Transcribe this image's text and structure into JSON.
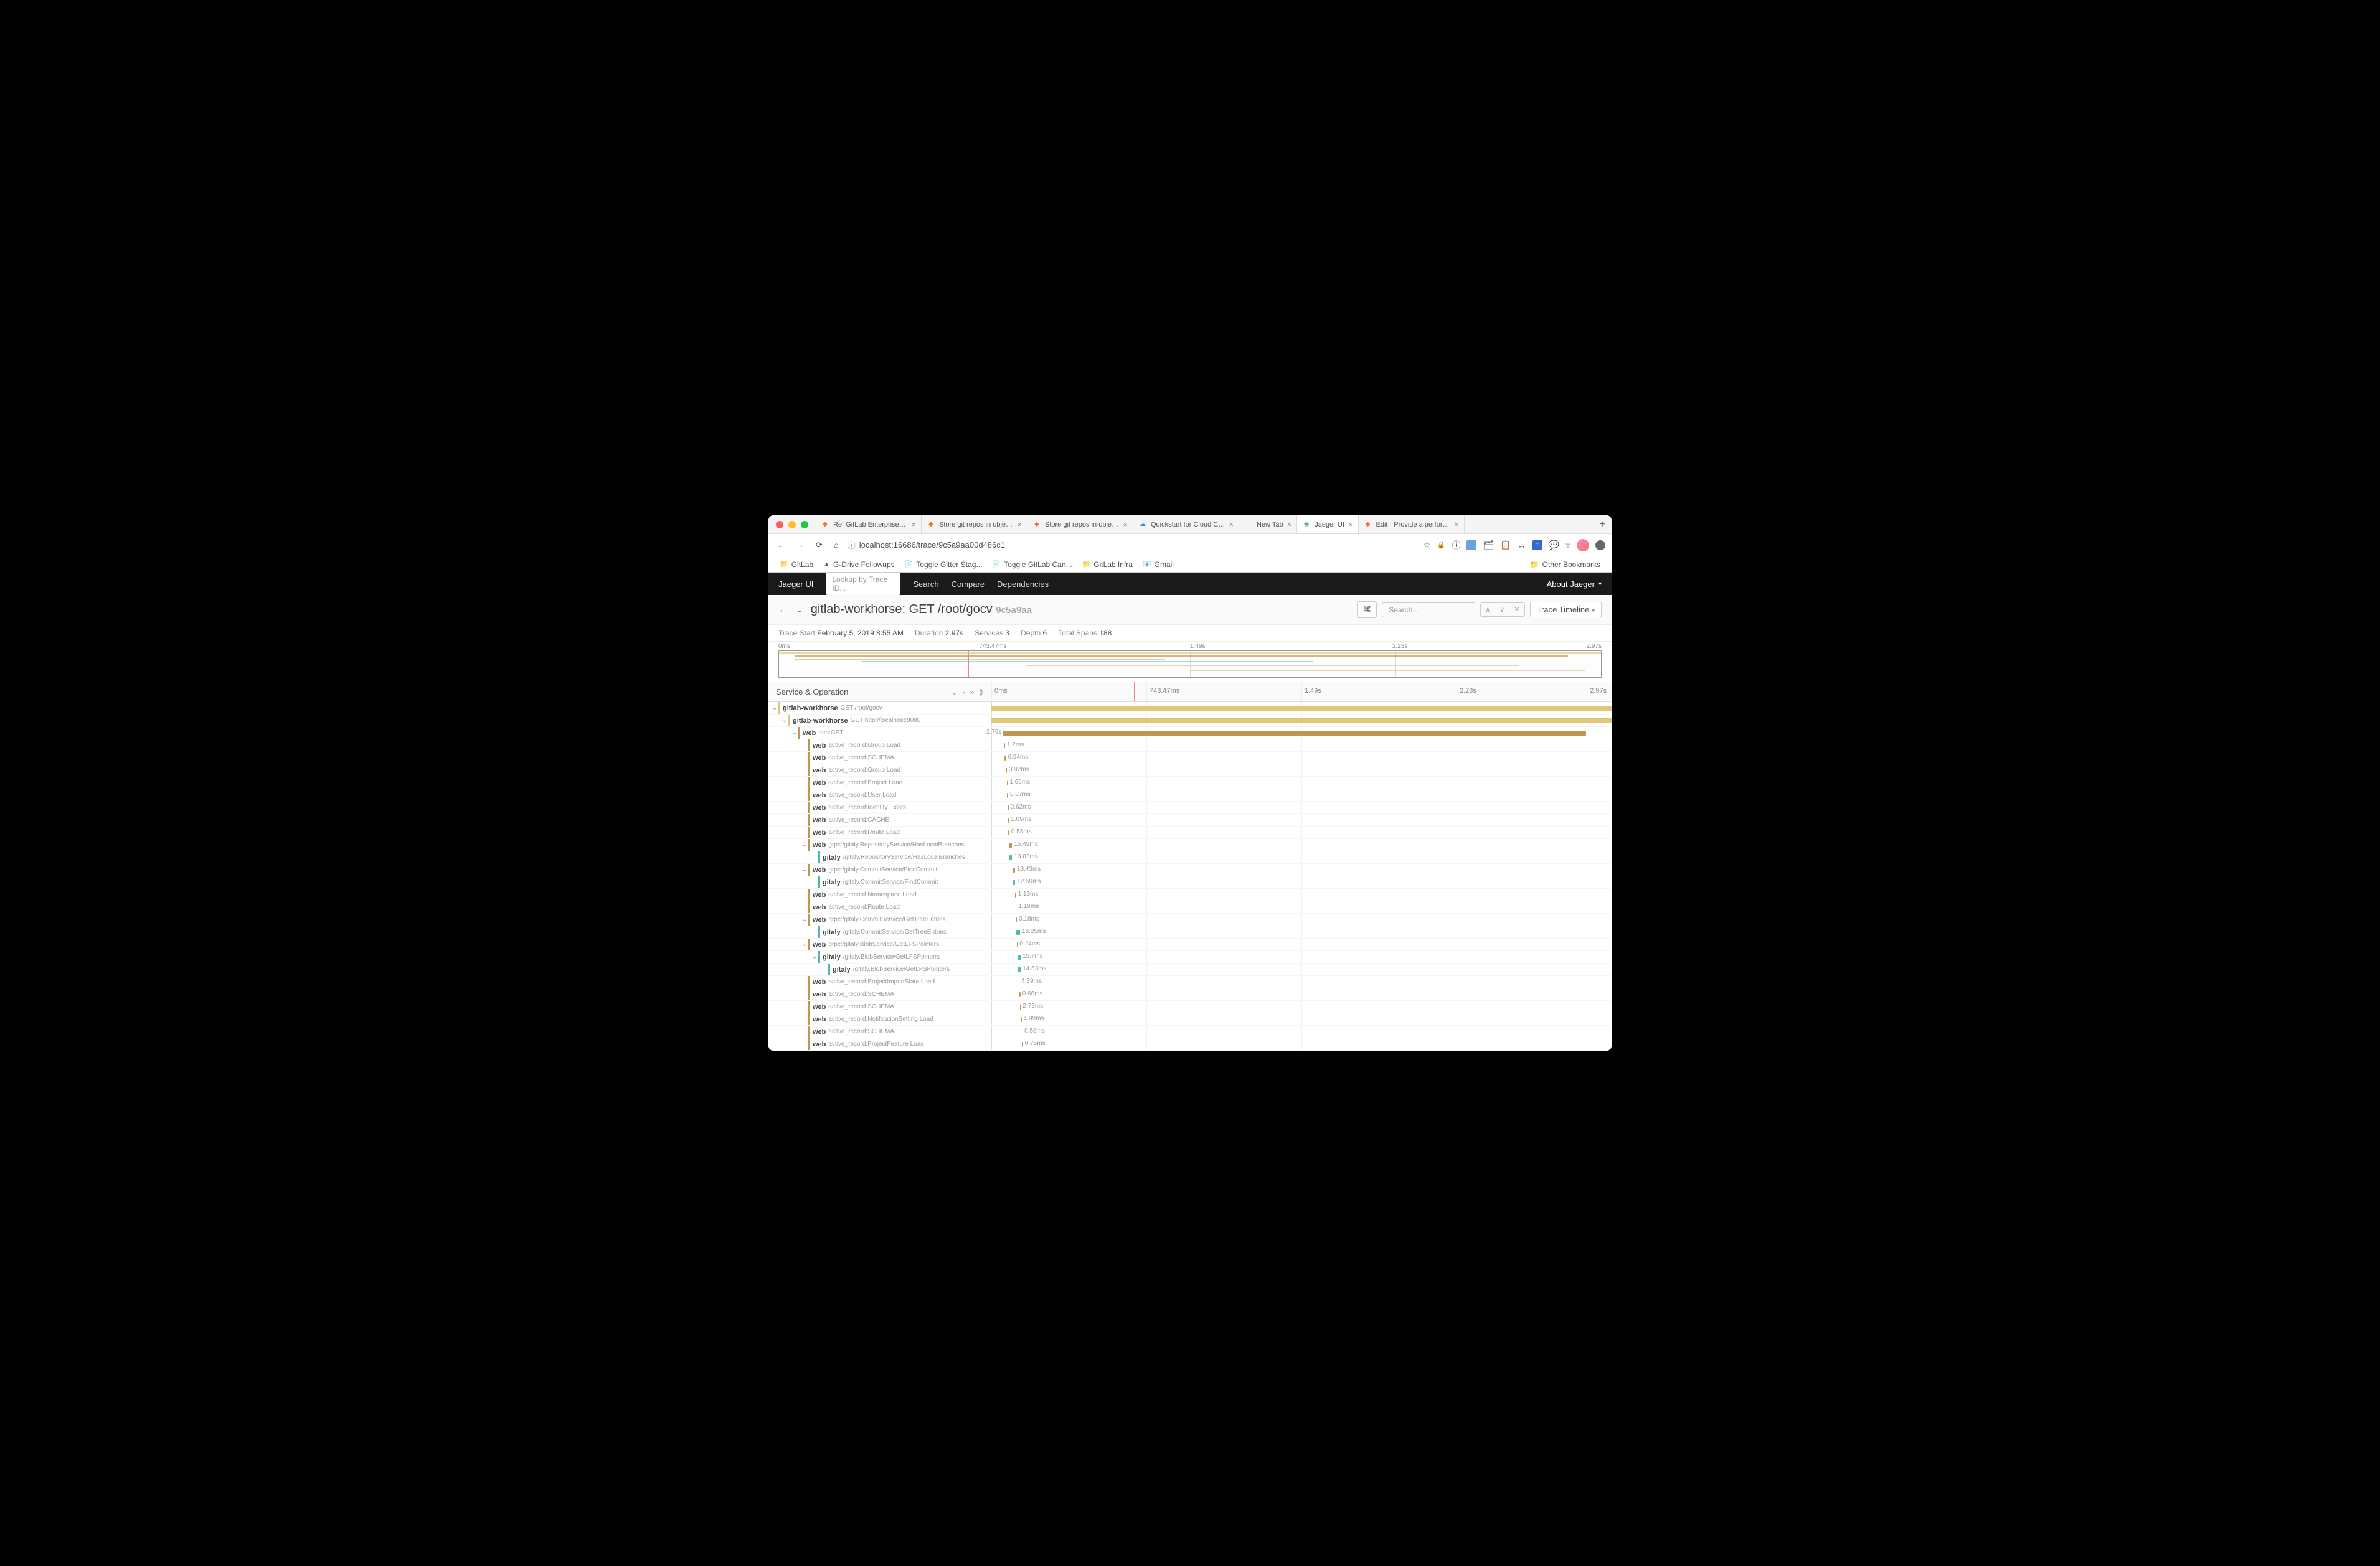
{
  "browser": {
    "tabs": [
      {
        "title": "Re: GitLab Enterprise Edition",
        "icon": "gitlab",
        "active": false
      },
      {
        "title": "Store git repos in object stora",
        "icon": "gitlab",
        "active": false
      },
      {
        "title": "Store git repos in object stora",
        "icon": "gitlab",
        "active": false
      },
      {
        "title": "Quickstart for Cloud CCC  |  C",
        "icon": "gcp",
        "active": false
      },
      {
        "title": "New Tab",
        "icon": "",
        "active": false
      },
      {
        "title": "Jaeger UI",
        "icon": "jaeger",
        "active": true
      },
      {
        "title": "Edit · Provide a performance i",
        "icon": "gitlab",
        "active": false
      }
    ],
    "url": "localhost:16686/trace/9c5a9aa00d486c1",
    "bookmarks": [
      "GitLab",
      "G-Drive Followups",
      "Toggle Gitter Stag...",
      "Toggle GitLab Can...",
      "GitLab Infra",
      "Gmail"
    ],
    "other_bookmarks": "Other Bookmarks"
  },
  "jaeger": {
    "logo": "Jaeger UI",
    "lookup_placeholder": "Lookup by Trace ID...",
    "nav": [
      "Search",
      "Compare",
      "Dependencies"
    ],
    "about": "About Jaeger"
  },
  "trace": {
    "title_service": "gitlab-workhorse:",
    "title_op": "GET /root/gocv",
    "id": "9c5a9aa",
    "search_placeholder": "Search...",
    "view": "Trace Timeline",
    "summary": {
      "start_label": "Trace Start",
      "start_value": "February 5, 2019 8:55 AM",
      "duration_label": "Duration",
      "duration_value": "2.97s",
      "services_label": "Services",
      "services_value": "3",
      "depth_label": "Depth",
      "depth_value": "6",
      "spans_label": "Total Spans",
      "spans_value": "188"
    },
    "ticks": [
      "0ms",
      "743.47ms",
      "1.49s",
      "2.23s",
      "2.97s"
    ],
    "col_left_title": "Service & Operation"
  },
  "spans": [
    {
      "indent": 0,
      "caret": true,
      "service": "gitlab-workhorse",
      "op": "GET /root/gocv",
      "color": "workhorse",
      "start": 0,
      "dur": 2970,
      "label": "",
      "labelSide": "none"
    },
    {
      "indent": 1,
      "caret": true,
      "service": "gitlab-workhorse",
      "op": "GET http://localhost:8080",
      "color": "workhorse",
      "start": 0,
      "dur": 2970,
      "label": "",
      "labelSide": "none"
    },
    {
      "indent": 2,
      "caret": true,
      "service": "web",
      "op": "http:GET",
      "color": "web",
      "start": 58,
      "dur": 2790,
      "label": "2.79s",
      "labelSide": "left"
    },
    {
      "indent": 3,
      "caret": false,
      "service": "web",
      "op": "active_record:Group Load",
      "color": "web",
      "start": 61,
      "dur": 1.2,
      "label": "1.2ms",
      "labelSide": "right"
    },
    {
      "indent": 3,
      "caret": false,
      "service": "web",
      "op": "active_record:SCHEMA",
      "color": "web",
      "start": 63,
      "dur": 6.94,
      "label": "6.94ms",
      "labelSide": "right"
    },
    {
      "indent": 3,
      "caret": false,
      "service": "web",
      "op": "active_record:Group Load",
      "color": "web",
      "start": 70,
      "dur": 3.92,
      "label": "3.92ms",
      "labelSide": "right"
    },
    {
      "indent": 3,
      "caret": false,
      "service": "web",
      "op": "active_record:Project Load",
      "color": "web",
      "start": 74,
      "dur": 1.65,
      "label": "1.65ms",
      "labelSide": "right"
    },
    {
      "indent": 3,
      "caret": false,
      "service": "web",
      "op": "active_record:User Load",
      "color": "web",
      "start": 76,
      "dur": 0.87,
      "label": "0.87ms",
      "labelSide": "right"
    },
    {
      "indent": 3,
      "caret": false,
      "service": "web",
      "op": "active_record:Identity Exists",
      "color": "web",
      "start": 78,
      "dur": 0.62,
      "label": "0.62ms",
      "labelSide": "right"
    },
    {
      "indent": 3,
      "caret": false,
      "service": "web",
      "op": "active_record:CACHE",
      "color": "web",
      "start": 80,
      "dur": 1.09,
      "label": "1.09ms",
      "labelSide": "right"
    },
    {
      "indent": 3,
      "caret": false,
      "service": "web",
      "op": "active_record:Route Load",
      "color": "web",
      "start": 82,
      "dur": 0.55,
      "label": "0.55ms",
      "labelSide": "right"
    },
    {
      "indent": 3,
      "caret": true,
      "service": "web",
      "op": "grpc:/gitaly.RepositoryService/HasLocalBranches",
      "color": "web",
      "start": 84,
      "dur": 15.49,
      "label": "15.49ms",
      "labelSide": "right"
    },
    {
      "indent": 4,
      "caret": false,
      "service": "gitaly",
      "op": "/gitaly.RepositoryService/HasLocalBranches",
      "color": "gitaly",
      "start": 86,
      "dur": 13.83,
      "label": "13.83ms",
      "labelSide": "right"
    },
    {
      "indent": 3,
      "caret": true,
      "service": "web",
      "op": "grpc:/gitaly.CommitService/FindCommit",
      "color": "web",
      "start": 100,
      "dur": 13.43,
      "label": "13.43ms",
      "labelSide": "right"
    },
    {
      "indent": 4,
      "caret": false,
      "service": "gitaly",
      "op": "/gitaly.CommitService/FindCommit",
      "color": "gitaly",
      "start": 101,
      "dur": 12.59,
      "label": "12.59ms",
      "labelSide": "right"
    },
    {
      "indent": 3,
      "caret": false,
      "service": "web",
      "op": "active_record:Namespace Load",
      "color": "web",
      "start": 114,
      "dur": 1.13,
      "label": "1.13ms",
      "labelSide": "right"
    },
    {
      "indent": 3,
      "caret": false,
      "service": "web",
      "op": "active_record:Route Load",
      "color": "web",
      "start": 116,
      "dur": 1.19,
      "label": "1.19ms",
      "labelSide": "right"
    },
    {
      "indent": 3,
      "caret": true,
      "service": "web",
      "op": "grpc:/gitaly.CommitService/GetTreeEntries",
      "color": "web",
      "start": 118,
      "dur": 0.18,
      "label": "0.18ms",
      "labelSide": "right"
    },
    {
      "indent": 4,
      "caret": false,
      "service": "gitaly",
      "op": "/gitaly.CommitService/GetTreeEntries",
      "color": "gitaly",
      "start": 119,
      "dur": 18.25,
      "label": "18.25ms",
      "labelSide": "right"
    },
    {
      "indent": 3,
      "caret": true,
      "service": "web",
      "op": "grpc:/gitaly.BlobService/GetLFSPointers",
      "color": "web",
      "start": 122,
      "dur": 0.24,
      "label": "0.24ms",
      "labelSide": "right"
    },
    {
      "indent": 4,
      "caret": true,
      "service": "gitaly",
      "op": "/gitaly.BlobService/GetLFSPointers",
      "color": "gitaly",
      "start": 124,
      "dur": 15.7,
      "label": "15.7ms",
      "labelSide": "right"
    },
    {
      "indent": 5,
      "caret": false,
      "service": "gitaly",
      "op": "/gitaly.BlobService/GetLFSPointers",
      "color": "gitaly",
      "start": 126,
      "dur": 14.63,
      "label": "14.63ms",
      "labelSide": "right"
    },
    {
      "indent": 3,
      "caret": false,
      "service": "web",
      "op": "active_record:ProjectImportState Load",
      "color": "web",
      "start": 130,
      "dur": 4.39,
      "label": "4.39ms",
      "labelSide": "right"
    },
    {
      "indent": 3,
      "caret": false,
      "service": "web",
      "op": "active_record:SCHEMA",
      "color": "web",
      "start": 135,
      "dur": 0.66,
      "label": "0.66ms",
      "labelSide": "right"
    },
    {
      "indent": 3,
      "caret": false,
      "service": "web",
      "op": "active_record:SCHEMA",
      "color": "web",
      "start": 137,
      "dur": 2.73,
      "label": "2.73ms",
      "labelSide": "right"
    },
    {
      "indent": 3,
      "caret": false,
      "service": "web",
      "op": "active_record:NotificationSetting Load",
      "color": "web",
      "start": 140,
      "dur": 4.99,
      "label": "4.99ms",
      "labelSide": "right"
    },
    {
      "indent": 3,
      "caret": false,
      "service": "web",
      "op": "active_record:SCHEMA",
      "color": "web",
      "start": 145,
      "dur": 0.58,
      "label": "0.58ms",
      "labelSide": "right"
    },
    {
      "indent": 3,
      "caret": false,
      "service": "web",
      "op": "active_record:ProjectFeature Load",
      "color": "web",
      "start": 147,
      "dur": 0.75,
      "label": "0.75ms",
      "labelSide": "right"
    }
  ],
  "total_ms": 2970
}
